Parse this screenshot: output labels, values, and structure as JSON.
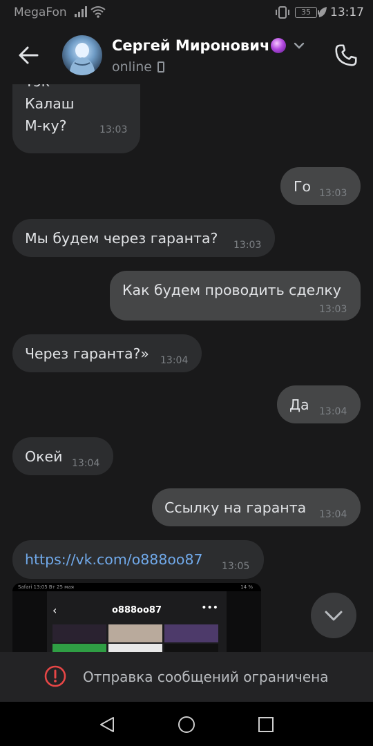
{
  "status_bar": {
    "carrier": "MegaFon",
    "battery": "35",
    "time": "13:17",
    "icons": [
      "signal-icon",
      "wifi-icon",
      "vibrate-icon",
      "battery-icon",
      "leaf-icon"
    ]
  },
  "header": {
    "contact_name": "Сергей Миронович",
    "status": "online",
    "icons": [
      "back-arrow-icon",
      "crystal-ball-icon",
      "chevron-down-icon",
      "mobile-icon",
      "phone-icon"
    ]
  },
  "messages": [
    {
      "dir": "in",
      "lines": [
        "Тэк",
        "Калаш",
        "М-ку?"
      ],
      "time": "13:03"
    },
    {
      "dir": "out",
      "text": "Го",
      "time": "13:03"
    },
    {
      "dir": "in",
      "text": "Мы будем через гаранта?",
      "time": "13:03"
    },
    {
      "dir": "out",
      "text": "Как будем проводить сделку",
      "time": "13:03"
    },
    {
      "dir": "in",
      "text": "Через гаранта?»",
      "time": "13:04"
    },
    {
      "dir": "out",
      "text": "Да",
      "time": "13:04"
    },
    {
      "dir": "in",
      "text": "Окей",
      "time": "13:04"
    },
    {
      "dir": "out",
      "text": "Ссылку на гаранта",
      "time": "13:04"
    },
    {
      "dir": "in",
      "link": "https://vk.com/o888oo87",
      "time": "13:05"
    }
  ],
  "preview": {
    "status_text": "Safari  13:05  Вт 25 мая",
    "status_right": "14 %",
    "title": "o888oo87"
  },
  "restriction": {
    "text": "Отправка сообщений ограничена"
  },
  "colors": {
    "background": "#19191a",
    "incoming_bubble": "#2c2d2f",
    "outgoing_bubble": "#454647",
    "link": "#71aaeb",
    "alert": "#e64646"
  }
}
